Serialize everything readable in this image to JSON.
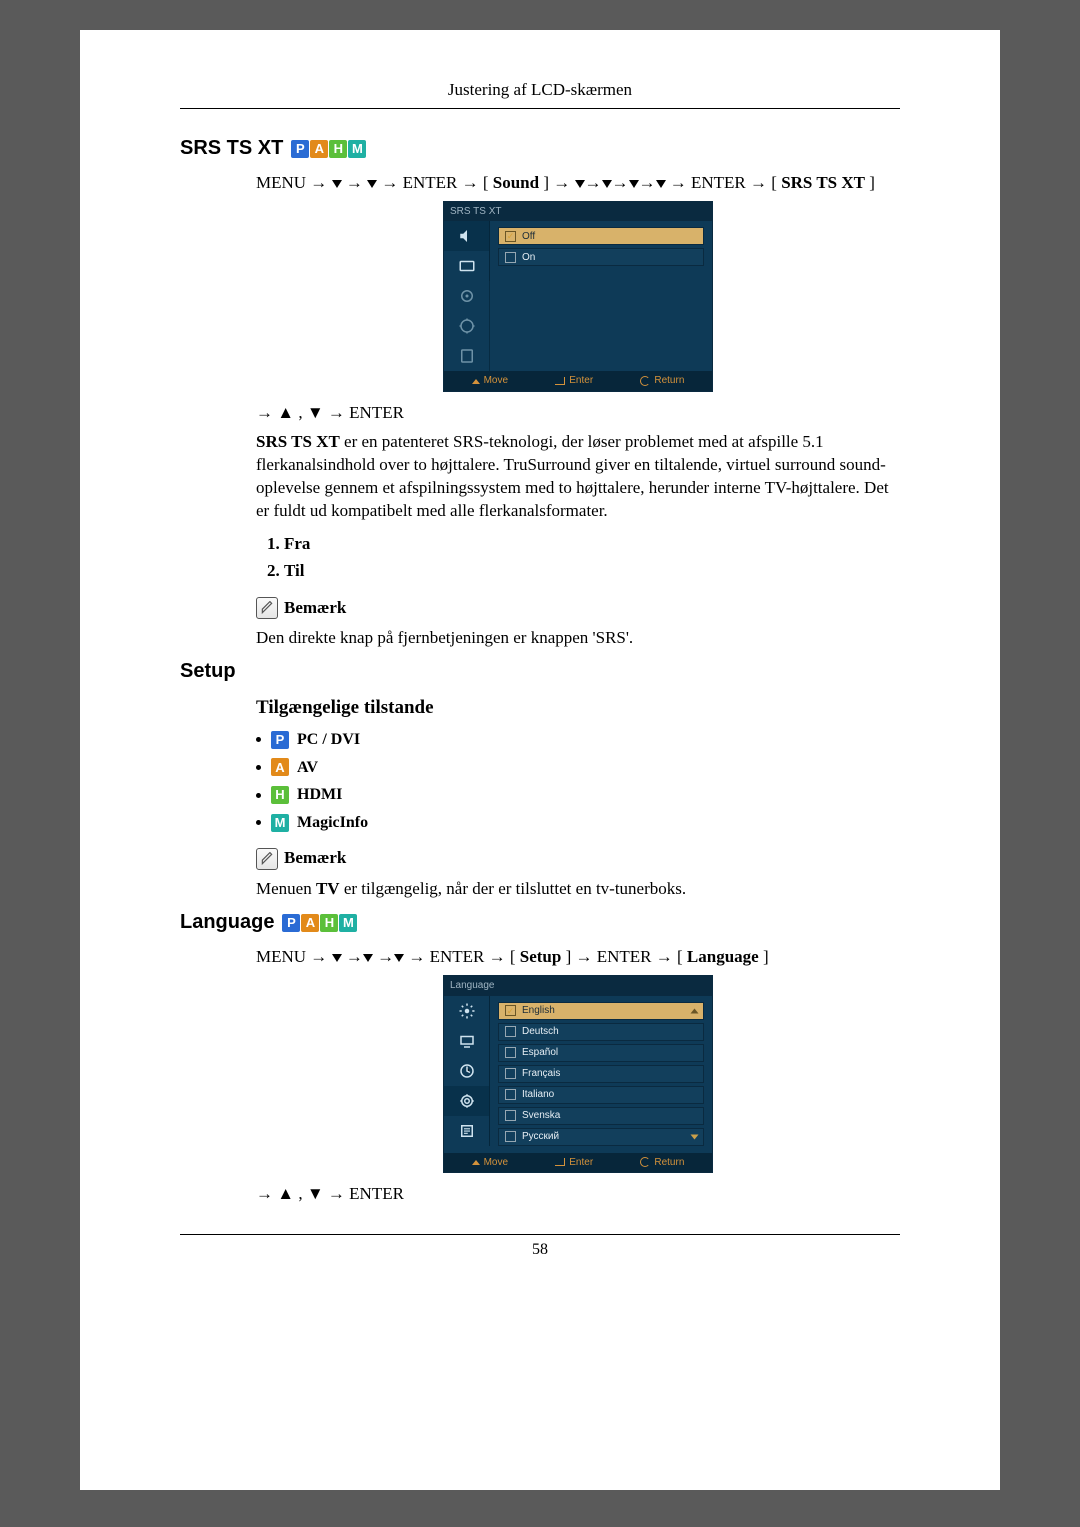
{
  "running_head": "Justering af LCD-skærmen",
  "page_number": "58",
  "badges": {
    "p": "P",
    "a": "A",
    "h": "H",
    "m": "M"
  },
  "srs": {
    "heading": "SRS TS XT",
    "nav_prefix": "MENU → ",
    "nav_mid1": " → ",
    "nav_enter1": " → ENTER → [",
    "nav_sound": "Sound",
    "nav_mid2": "] →",
    "nav_enter2": "→ ENTER → [",
    "nav_target": "SRS TS XT",
    "nav_suffix": "]",
    "post_nav": "→ ▲ , ▼ → ENTER",
    "body_pre": "SRS TS XT",
    "body": " er en patenteret SRS-teknologi, der løser problemet med at afspille 5.1 flerkanalsindhold over to højttalere. TruSurround giver en tiltalende, virtuel surround sound-oplevelse gennem et afspilningssystem med to højttalere, herunder interne TV-højttalere. Det er fuldt ud kompatibelt med alle flerkanalsformater.",
    "options": [
      "Fra",
      "Til"
    ],
    "note_label": "Bemærk",
    "note_body": "Den direkte knap på fjernbetjeningen er knappen 'SRS'.",
    "osd": {
      "title": "SRS TS XT",
      "rows": [
        {
          "label": "Off",
          "selected": true,
          "check": true
        },
        {
          "label": "On",
          "selected": false,
          "check": false
        }
      ],
      "footer": {
        "move": "Move",
        "enter": "Enter",
        "ret": "Return"
      }
    }
  },
  "setup": {
    "heading": "Setup",
    "sub": "Tilgængelige tilstande",
    "modes": [
      {
        "badge": "p",
        "label": "PC / DVI"
      },
      {
        "badge": "a",
        "label": "AV"
      },
      {
        "badge": "h",
        "label": "HDMI"
      },
      {
        "badge": "m",
        "label": "MagicInfo"
      }
    ],
    "note_label": "Bemærk",
    "note_body_pre": "Menuen ",
    "note_bold": "TV",
    "note_body_post": " er tilgængelig, når der er tilsluttet en tv-tunerboks."
  },
  "language": {
    "heading": "Language",
    "nav_prefix": "MENU → ",
    "nav_enter1": " → ENTER → [",
    "nav_setup": "Setup",
    "nav_mid": "] → ENTER → [",
    "nav_target": "Language",
    "nav_suffix": " ]",
    "post_nav": "→ ▲ , ▼ → ENTER",
    "osd": {
      "title": "Language",
      "rows": [
        {
          "label": "English",
          "selected": true,
          "check": true,
          "arrow": true
        },
        {
          "label": "Deutsch",
          "selected": false
        },
        {
          "label": "Español",
          "selected": false
        },
        {
          "label": "Français",
          "selected": false
        },
        {
          "label": "Italiano",
          "selected": false
        },
        {
          "label": "Svenska",
          "selected": false
        },
        {
          "label": "Русский",
          "selected": false,
          "arrow": true
        }
      ],
      "footer": {
        "move": "Move",
        "enter": "Enter",
        "ret": "Return"
      }
    }
  }
}
